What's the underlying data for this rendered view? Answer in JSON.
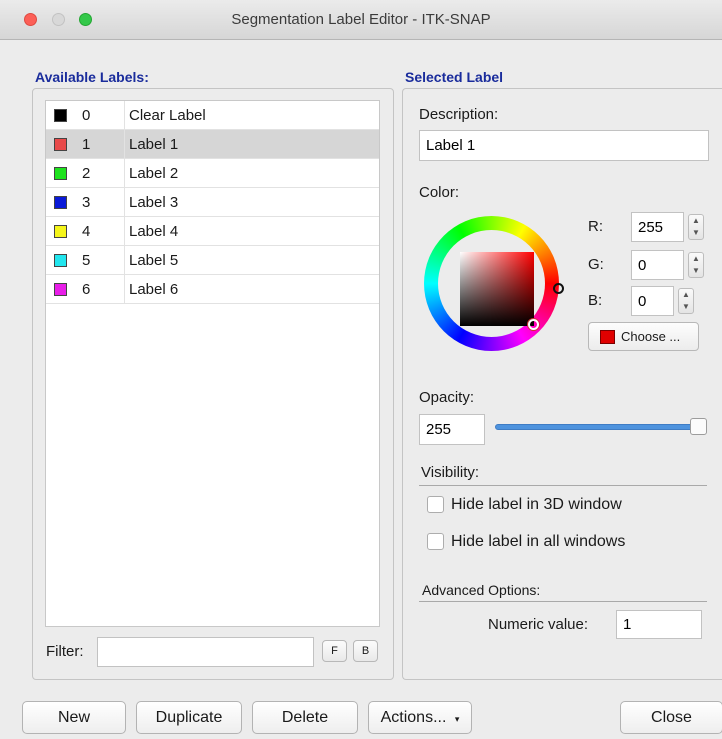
{
  "window": {
    "title": "Segmentation Label Editor - ITK-SNAP"
  },
  "available": {
    "heading": "Available Labels:",
    "labels": [
      {
        "num": "0",
        "name": "Clear Label",
        "color": "#000000"
      },
      {
        "num": "1",
        "name": "Label 1",
        "color": "#e84a4a"
      },
      {
        "num": "2",
        "name": "Label 2",
        "color": "#1ee21e"
      },
      {
        "num": "3",
        "name": "Label 3",
        "color": "#0a1ad8"
      },
      {
        "num": "4",
        "name": "Label 4",
        "color": "#f5f51a"
      },
      {
        "num": "5",
        "name": "Label 5",
        "color": "#22e6ee"
      },
      {
        "num": "6",
        "name": "Label 6",
        "color": "#e81ee8"
      }
    ],
    "selected_index": 1,
    "filter_label": "Filter:",
    "filter_value": "",
    "f_button": "F",
    "b_button": "B"
  },
  "selected": {
    "heading": "Selected Label",
    "description_label": "Description:",
    "description_value": "Label 1",
    "color_label": "Color:",
    "r_label": "R:",
    "r_value": "255",
    "g_label": "G:",
    "g_value": "0",
    "b_label": "B:",
    "b_value": "0",
    "choose_label": "Choose ...",
    "current_color": "#e00000",
    "opacity_label": "Opacity:",
    "opacity_value": "255",
    "visibility_label": "Visibility:",
    "hide_3d_label": "Hide label in 3D window",
    "hide_3d_checked": false,
    "hide_all_label": "Hide label in all windows",
    "hide_all_checked": false,
    "advanced_label": "Advanced Options:",
    "numeric_label": "Numeric value:",
    "numeric_value": "1"
  },
  "buttons": {
    "new": "New",
    "duplicate": "Duplicate",
    "delete": "Delete",
    "actions": "Actions...",
    "close": "Close"
  }
}
